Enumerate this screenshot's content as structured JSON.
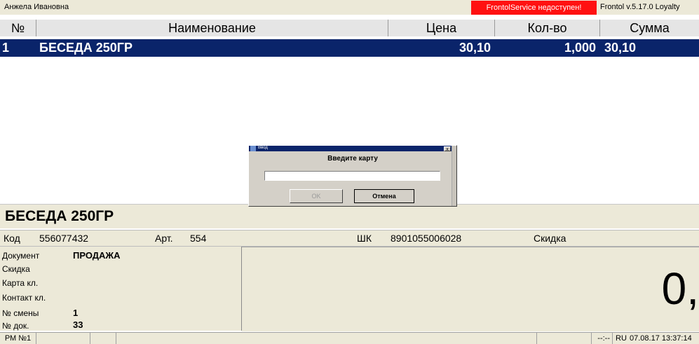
{
  "topbar": {
    "user": "Анжела Ивановна",
    "service_warning": "FrontolService недоступен!",
    "version": "Frontol v.5.17.0 Loyalty"
  },
  "colors": {
    "selection": "#0a246a",
    "warning": "#ff1111",
    "panel": "#ece9d8"
  },
  "grid": {
    "columns": [
      "№",
      "Наименование",
      "Цена",
      "Кол-во",
      "Сумма"
    ],
    "rows": [
      {
        "num": "1",
        "name": "БЕСЕДА 250ГР",
        "price": "30,10",
        "qty": "1,000",
        "sum": "30,10"
      }
    ]
  },
  "product": {
    "name": "БЕСЕДА 250ГР",
    "code_label": "Код",
    "code": "556077432",
    "art_label": "Арт.",
    "art": "554",
    "barcode_label": "ШК",
    "barcode": "8901055006028",
    "discount_label": "Скидка"
  },
  "info": {
    "document_label": "Документ",
    "document_value": "ПРОДАЖА",
    "discount_label": "Скидка",
    "card_label": "Карта кл.",
    "contact_label": "Контакт кл.",
    "shift_label": "№ смены",
    "shift_value": "1",
    "doc_no_label": "№ док.",
    "doc_no_value": "33"
  },
  "total": {
    "value": "0,"
  },
  "statusbar": {
    "workstation": "РМ №1",
    "placeholder": "--:--",
    "lang": "RU",
    "datetime": "07.08.17  13:37:14"
  },
  "dialog": {
    "title": "Ввод",
    "prompt": "Введите карту",
    "input_value": "",
    "ok_label": "OK",
    "cancel_label": "Отмена",
    "close_glyph": "x"
  }
}
